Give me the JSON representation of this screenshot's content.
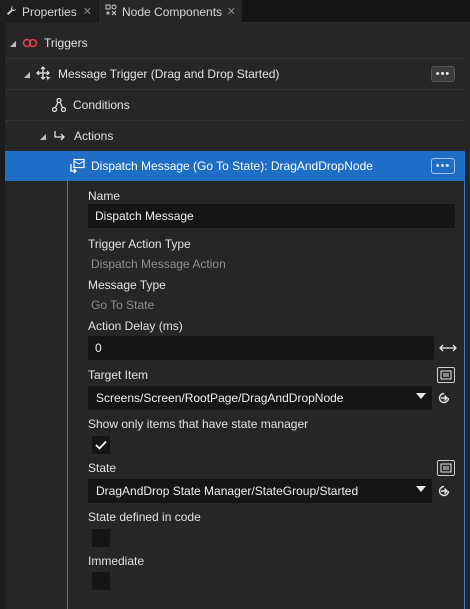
{
  "tabs": [
    {
      "label": "Properties",
      "icon": "wrench-icon",
      "active": false
    },
    {
      "label": "Node Components",
      "icon": "component-icon",
      "active": true
    }
  ],
  "tree": {
    "triggers_label": "Triggers",
    "message_trigger_label": "Message Trigger (Drag and Drop Started)",
    "conditions_label": "Conditions",
    "actions_label": "Actions",
    "dispatch_label": "Dispatch Message (Go To State): DragAndDropNode",
    "more_label": "•••"
  },
  "details": {
    "name_label": "Name",
    "name_value": "Dispatch Message",
    "trigger_action_type_label": "Trigger Action Type",
    "trigger_action_type_value": "Dispatch Message Action",
    "message_type_label": "Message Type",
    "message_type_value": "Go To State",
    "action_delay_label": "Action Delay (ms)",
    "action_delay_value": "0",
    "target_item_label": "Target Item",
    "target_item_value": "Screens/Screen/RootPage/DragAndDropNode",
    "state_manager_only_label": "Show only items that have state manager",
    "state_manager_only_checked": true,
    "state_label": "State",
    "state_value": "DragAndDrop State Manager/StateGroup/Started",
    "state_in_code_label": "State defined in code",
    "state_in_code_checked": false,
    "immediate_label": "Immediate",
    "immediate_checked": false
  },
  "colors": {
    "selection": "#1e6ec6",
    "panel": "#262626",
    "field": "#151515",
    "trigger_icon": "#e0434a"
  }
}
